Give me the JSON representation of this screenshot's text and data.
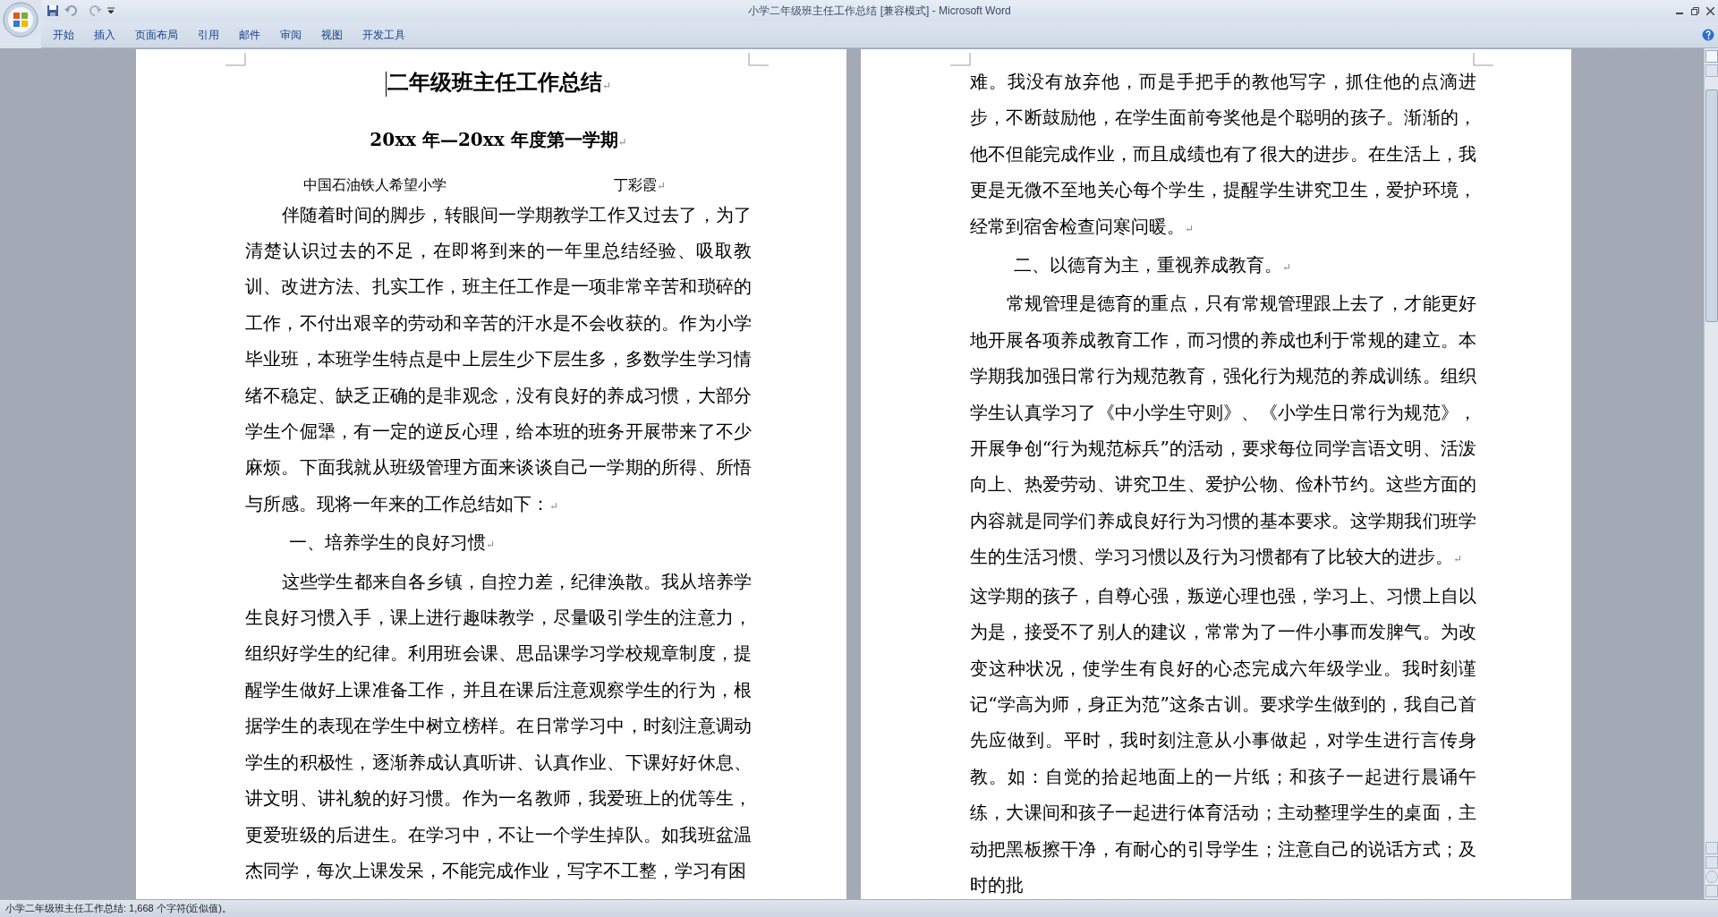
{
  "window": {
    "title": "小学二年级班主任工作总结 [兼容模式] - Microsoft Word"
  },
  "ribbon_tabs": [
    "开始",
    "插入",
    "页面布局",
    "引用",
    "邮件",
    "审阅",
    "视图",
    "开发工具"
  ],
  "paragraph_mark": "↵",
  "pages": [
    {
      "title": "二年级班主任工作总结",
      "subtitle": "20xx 年—20xx 年度第一学期",
      "author": {
        "school": "中国石油铁人希望小学",
        "name": "丁彩霞"
      },
      "paragraphs": [
        {
          "kind": "body",
          "ends": true,
          "text": "伴随着时间的脚步，转眼间一学期教学工作又过去了，为了清楚认识过去的不足，在即将到来的一年里总结经验、吸取教训、改进方法、扎实工作，班主任工作是一项非常辛苦和琐碎的工作，不付出艰辛的劳动和辛苦的汗水是不会收获的。作为小学毕业班，本班学生特点是中上层生少下层生多，多数学生学习情绪不稳定、缺乏正确的是非观念，没有良好的养成习惯，大部分学生个倔犟，有一定的逆反心理，给本班的班务开展带来了不少麻烦。下面我就从班级管理方面来谈谈自己一学期的所得、所悟与所感。现将一年来的工作总结如下："
        },
        {
          "kind": "heading",
          "ends": true,
          "text": "一、培养学生的良好习惯"
        },
        {
          "kind": "body",
          "ends": false,
          "text": "这些学生都来自各乡镇，自控力差，纪律涣散。我从培养学生良好习惯入手，课上进行趣味教学，尽量吸引学生的注意力，组织好学生的纪律。利用班会课、思品课学习学校规章制度，提醒学生做好上课准备工作，并且在课后注意观察学生的行为，根据学生的表现在学生中树立榜样。在日常学习中，时刻注意调动学生的积极性，逐渐养成认真听讲、认真作业、下课好好休息、讲文明、讲礼貌的好习惯。作为一名教师，我爱班上的优等生，更爱班级的后进生。在学习中，不让一个学生掉队。如我班盆温杰同学，每次上课发呆，不能完成作业，写字不工整，学习有困"
        }
      ]
    },
    {
      "paragraphs": [
        {
          "kind": "continuation",
          "ends": true,
          "text": "难。我没有放弃他，而是手把手的教他写字，抓住他的点滴进步，不断鼓励他，在学生面前夸奖他是个聪明的孩子。渐渐的，他不但能完成作业，而且成绩也有了很大的进步。在生活上，我更是无微不至地关心每个学生，提醒学生讲究卫生，爱护环境，经常到宿舍检查问寒问暖。"
        },
        {
          "kind": "heading",
          "ends": true,
          "text": "二、以德育为主，重视养成教育。"
        },
        {
          "kind": "body",
          "ends": true,
          "text": "常规管理是德育的重点，只有常规管理跟上去了，才能更好地开展各项养成教育工作，而习惯的养成也利于常规的建立。本学期我加强日常行为规范教育，强化行为规范的养成训练。组织学生认真学习了《中小学生守则》、《小学生日常行为规范》，开展争创“行为规范标兵”的活动，要求每位同学言语文明、活泼向上、热爱劳动、讲究卫生、爱护公物、俭朴节约。这些方面的内容就是同学们养成良好行为习惯的基本要求。这学期我们班学生的生活习惯、学习习惯以及行为习惯都有了比较大的进步。"
        },
        {
          "kind": "continuation",
          "ends": false,
          "text": "这学期的孩子，自尊心强，叛逆心理也强，学习上、习惯上自以为是，接受不了别人的建议，常常为了一件小事而发脾气。为改变这种状况，使学生有良好的心态完成六年级学业。我时刻谨记“学高为师，身正为范”这条古训。要求学生做到的，我自己首先应做到。平时，我时刻注意从小事做起，对学生进行言传身教。如：自觉的拾起地面上的一片纸；和孩子一起进行晨诵午练，大课间和孩子一起进行体育活动；主动整理学生的桌面，主动把黑板擦干净，有耐心的引导学生；注意自己的说话方式；及时的批"
        }
      ]
    }
  ],
  "status_bar": {
    "text": "小学二年级班主任工作总结: 1,668 个字符(近似值)。"
  }
}
